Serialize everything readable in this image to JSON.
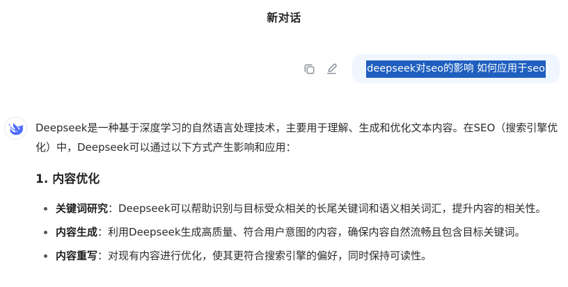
{
  "header": {
    "title": "新对话"
  },
  "user_message": {
    "text": "deepseek对seo的影响 如何应用于seo",
    "actions": [
      {
        "name": "copy-icon"
      },
      {
        "name": "edit-icon"
      }
    ]
  },
  "assistant_message": {
    "avatar_icon": "deepseek-whale-icon",
    "intro": "Deepseek是一种基于深度学习的自然语言处理技术，主要用于理解、生成和优化文本内容。在SEO（搜索引擎优化）中，Deepseek可以通过以下方式产生影响和应用：",
    "section_heading": "1. 内容优化",
    "bullets": [
      {
        "term": "关键词研究",
        "sep": "：",
        "text": "Deepseek可以帮助识别与目标受众相关的长尾关键词和语义相关词汇，提升内容的相关性。"
      },
      {
        "term": "内容生成",
        "sep": "：",
        "text": "利用Deepseek生成高质量、符合用户意图的内容，确保内容自然流畅且包含目标关键词。"
      },
      {
        "term": "内容重写",
        "sep": "：",
        "text": "对现有内容进行优化，使其更符合搜索引擎的偏好，同时保持可读性。"
      }
    ]
  },
  "colors": {
    "accent_blue": "#4d6bfe",
    "selection": "#1f5fbf",
    "bubble_bg": "#eff6ff",
    "icon_gray": "#8a8f99"
  }
}
